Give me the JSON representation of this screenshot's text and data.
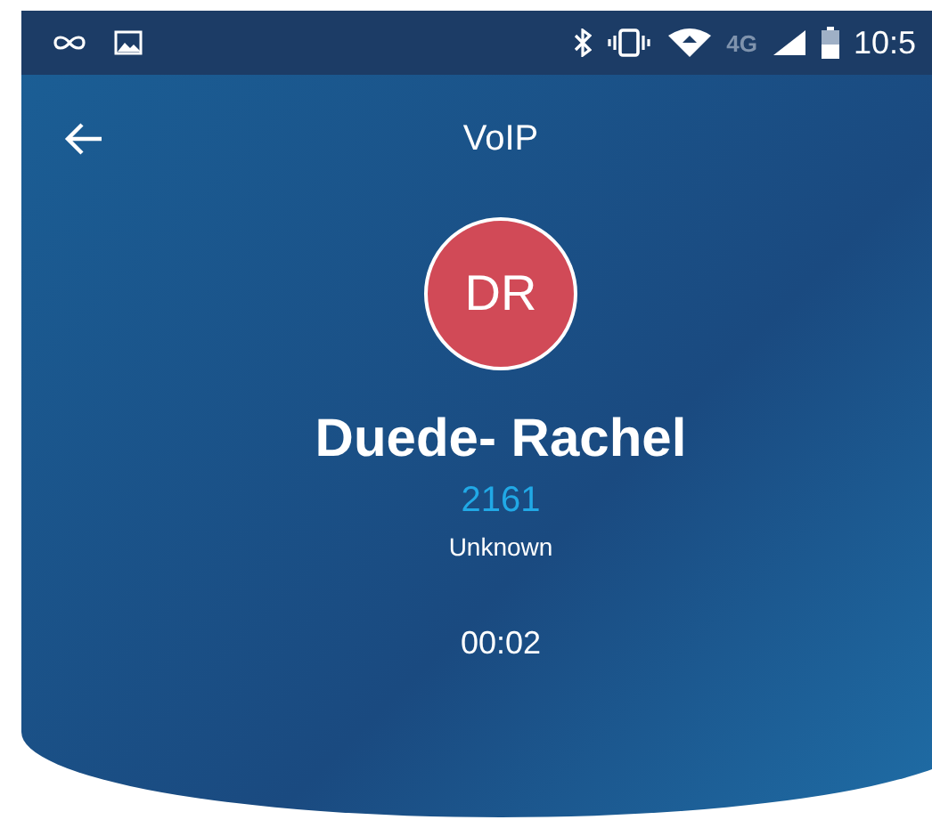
{
  "status_bar": {
    "network": "4G",
    "time": "10:5"
  },
  "app_bar": {
    "title": "VoIP"
  },
  "caller": {
    "initials": "DR",
    "name": "Duede- Rachel",
    "number": "2161",
    "label": "Unknown"
  },
  "call_timer": "00:02"
}
